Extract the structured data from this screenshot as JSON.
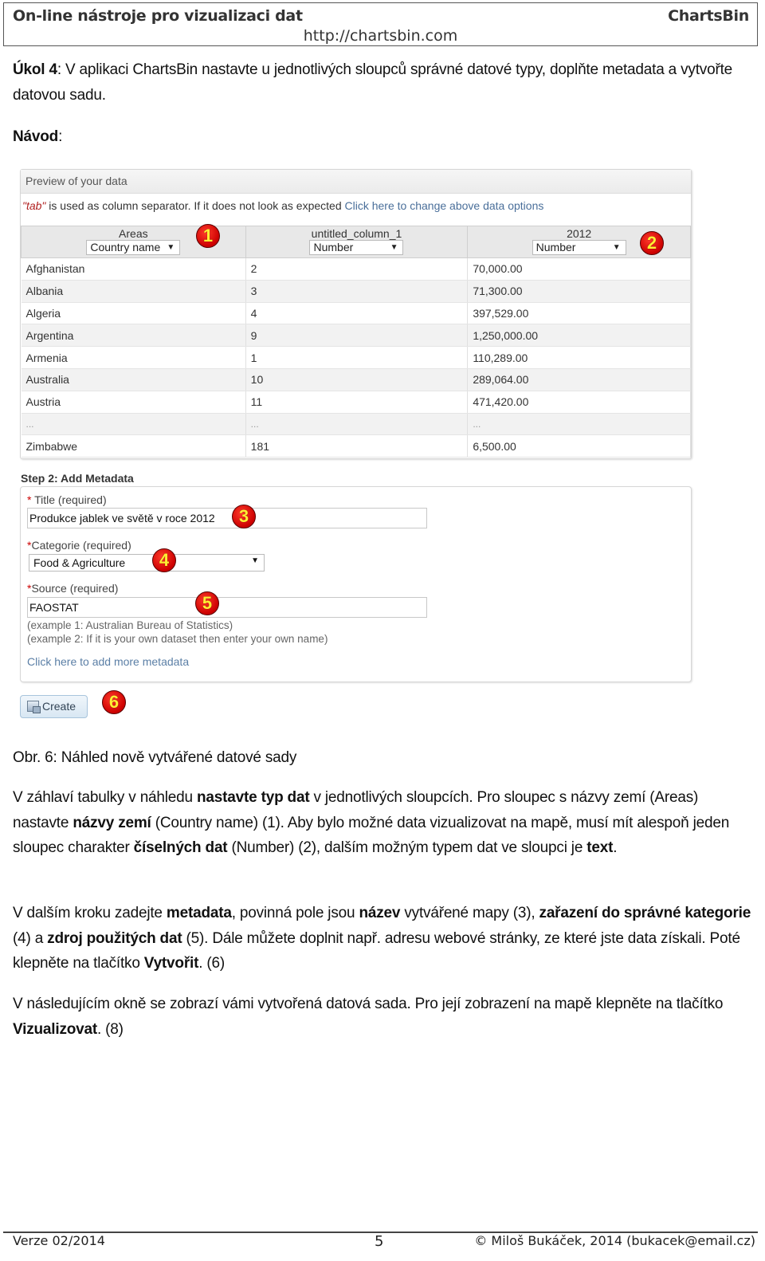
{
  "header": {
    "title": "On-line nástroje pro vizualizaci dat",
    "brand": "ChartsBin",
    "url": "http://chartsbin.com"
  },
  "task": {
    "label": "Úkol 4",
    "text": ": V aplikaci ChartsBin nastavte u jednotlivých sloupců správné datové typy, doplňte metadata a vytvořte datovou sadu."
  },
  "guide": {
    "label": "Návod",
    "colon": ":"
  },
  "preview": {
    "heading": "Preview of your data",
    "separator_word": "\"tab\"",
    "separator_text": " is used as column separator. If it does not look as expected ",
    "change_link": "Click here to change above data options",
    "columns": [
      {
        "name": "Areas",
        "type": "Country name"
      },
      {
        "name": "untitled_column_1",
        "type": "Number"
      },
      {
        "name": "2012",
        "type": "Number"
      }
    ],
    "rows": [
      [
        "Afghanistan",
        "2",
        "70,000.00"
      ],
      [
        "Albania",
        "3",
        "71,300.00"
      ],
      [
        "Algeria",
        "4",
        "397,529.00"
      ],
      [
        "Argentina",
        "9",
        "1,250,000.00"
      ],
      [
        "Armenia",
        "1",
        "110,289.00"
      ],
      [
        "Australia",
        "10",
        "289,064.00"
      ],
      [
        "Austria",
        "11",
        "471,420.00"
      ],
      [
        "...",
        "...",
        "..."
      ],
      [
        "Zimbabwe",
        "181",
        "6,500.00"
      ]
    ],
    "dropdown_arrow": "▼"
  },
  "metadata": {
    "heading": "Step 2: Add Metadata",
    "title_label": "Title (required)",
    "title_value": "Produkce jablek ve světě v roce 2012",
    "category_label": "Categorie (required)",
    "category_value": "Food & Agriculture",
    "source_label": "Source (required)",
    "source_value": "FAOSTAT",
    "hint1": "(example 1: Australian Bureau of Statistics)",
    "hint2": "(example 2: If it is your own dataset then enter your own name)",
    "more_link": "Click here to add more metadata",
    "required_mark": "*"
  },
  "create_button": "Create",
  "badges": [
    "1",
    "2",
    "3",
    "4",
    "5",
    "6"
  ],
  "caption": "Obr. 6: Náhled nově vytvářené datové sady",
  "paragraphs": {
    "p1": {
      "a": "V záhlaví tabulky v náhledu ",
      "b1": "nastavte typ dat",
      "c": " v jednotlivých sloupcích. Pro sloupec s názvy zemí (Areas) nastavte ",
      "b2": "názvy zemí",
      "d": " (Country name) (1). Aby bylo možné data vizualizovat na mapě, musí mít alespoň jeden sloupec charakter ",
      "b3": "číselných dat",
      "e": " (Number) (2), dalším možným typem dat ve sloupci je ",
      "b4": "text",
      "f": "."
    },
    "p2": {
      "a": "V dalším kroku zadejte ",
      "b1": "metadata",
      "c": ", povinná pole jsou ",
      "b2": "název",
      "d": " vytvářené mapy (3), ",
      "b3": "zařazení do správné kategorie",
      "e": " (4) a ",
      "b4": "zdroj použitých dat",
      "f": " (5). Dále můžete doplnit např. adresu webové stránky, ze které jste data získali. Poté klepněte na tlačítko ",
      "b5": "Vytvořit",
      "g": ". (6)"
    },
    "p3": {
      "a": "V následujícím okně se zobrazí vámi vytvořená datová sada. Pro její zobrazení na mapě klepněte na tlačítko ",
      "b1": "Vizualizovat",
      "c": ". (8)"
    }
  },
  "footer": {
    "version": "Verze 02/2014",
    "page": "5",
    "copyright": "© Miloš Bukáček, 2014 (bukacek@email.cz)"
  }
}
